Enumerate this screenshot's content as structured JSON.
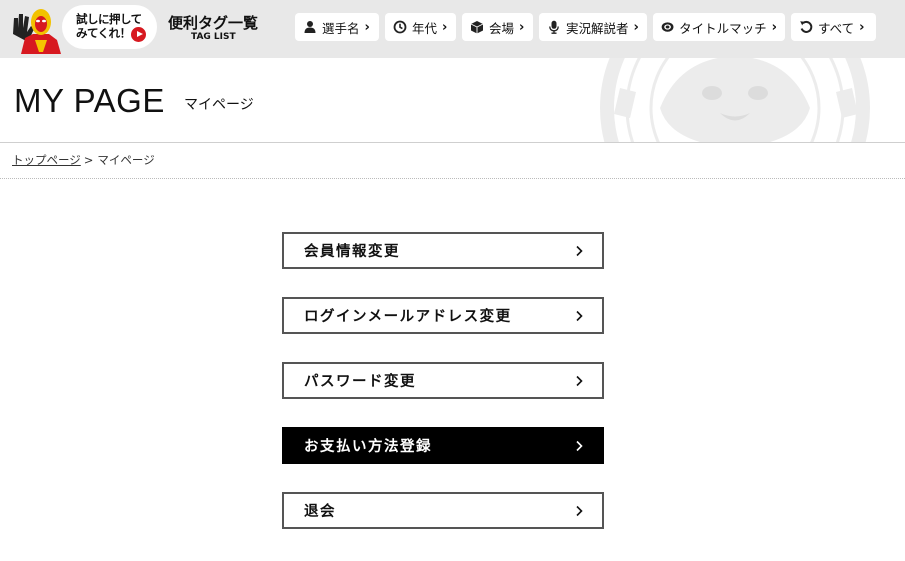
{
  "topbar": {
    "bubble_text": "試しに押して\nみてくれ！",
    "tag_title": "便利タグ一覧",
    "tag_subtitle": "TAG LIST",
    "nav": [
      {
        "label": "選手名",
        "icon": "person-icon"
      },
      {
        "label": "年代",
        "icon": "clock-icon"
      },
      {
        "label": "会場",
        "icon": "box-icon"
      },
      {
        "label": "実況解説者",
        "icon": "microphone-icon"
      },
      {
        "label": "タイトルマッチ",
        "icon": "belt-icon"
      },
      {
        "label": "すべて",
        "icon": "reload-icon"
      }
    ]
  },
  "header": {
    "title": "MY PAGE",
    "subtitle": "マイページ"
  },
  "breadcrumb": {
    "home": "トップページ",
    "separator": ">",
    "current": "マイページ"
  },
  "menu": [
    {
      "label": "会員情報変更",
      "active": false
    },
    {
      "label": "ログインメールアドレス変更",
      "active": false
    },
    {
      "label": "パスワード変更",
      "active": false
    },
    {
      "label": "お支払い方法登録",
      "active": true
    },
    {
      "label": "退会",
      "active": false
    }
  ],
  "colors": {
    "topbar_bg": "#e8e8e8",
    "accent_red": "#d71920",
    "active_bg": "#000000"
  }
}
